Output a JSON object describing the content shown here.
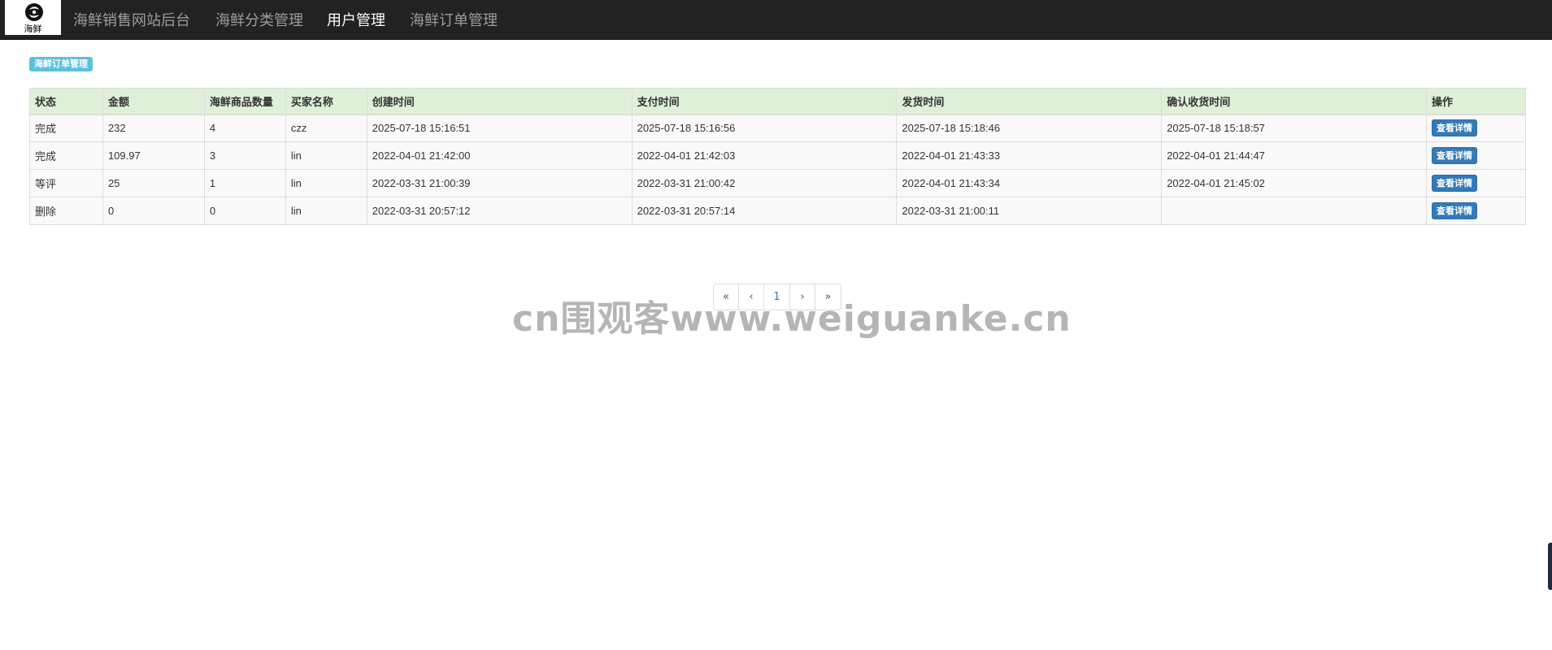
{
  "brand": {
    "logo_text": "海鲜",
    "logo_icon": "seafood-logo-icon"
  },
  "nav": {
    "items": [
      {
        "label": "海鲜销售网站后台",
        "active": false
      },
      {
        "label": "海鲜分类管理",
        "active": false
      },
      {
        "label": "用户管理",
        "active": true
      },
      {
        "label": "海鲜订单管理",
        "active": false
      }
    ]
  },
  "page": {
    "badge": "海鲜订单管理"
  },
  "table": {
    "headers": [
      "状态",
      "金额",
      "海鲜商品数量",
      "买家名称",
      "创建时间",
      "支付时间",
      "发货时间",
      "确认收货时间",
      "操作"
    ],
    "rows": [
      {
        "status": "完成",
        "amount": "232",
        "qty": "4",
        "buyer": "czz",
        "created": "2025-07-18 15:16:51",
        "paid": "2025-07-18 15:16:56",
        "shipped": "2025-07-18 15:18:46",
        "received": "2025-07-18 15:18:57",
        "action": "查看详情"
      },
      {
        "status": "完成",
        "amount": "109.97",
        "qty": "3",
        "buyer": "lin",
        "created": "2022-04-01 21:42:00",
        "paid": "2022-04-01 21:42:03",
        "shipped": "2022-04-01 21:43:33",
        "received": "2022-04-01 21:44:47",
        "action": "查看详情"
      },
      {
        "status": "等评",
        "amount": "25",
        "qty": "1",
        "buyer": "lin",
        "created": "2022-03-31 21:00:39",
        "paid": "2022-03-31 21:00:42",
        "shipped": "2022-04-01 21:43:34",
        "received": "2022-04-01 21:45:02",
        "action": "查看详情"
      },
      {
        "status": "删除",
        "amount": "0",
        "qty": "0",
        "buyer": "lin",
        "created": "2022-03-31 20:57:12",
        "paid": "2022-03-31 20:57:14",
        "shipped": "2022-03-31 21:00:11",
        "received": "",
        "action": "查看详情"
      }
    ]
  },
  "pagination": {
    "first": "«",
    "prev": "‹",
    "current": "1",
    "next": "›",
    "last": "»"
  },
  "watermark": "cn围观客www.weiguanke.cn",
  "colors": {
    "navbar": "#222222",
    "header_row": "#dff0d8",
    "badge": "#5bc0de",
    "button": "#337ab7",
    "nav_active": "#ffffff",
    "nav_inactive": "#9d9d9d"
  }
}
